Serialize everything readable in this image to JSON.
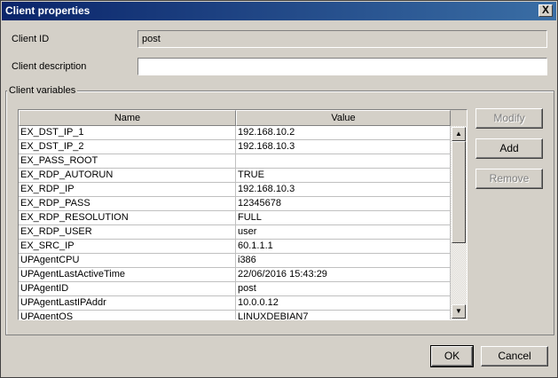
{
  "window": {
    "title": "Client properties",
    "close_glyph": "X"
  },
  "form": {
    "client_id_label": "Client ID",
    "client_id_value": "post",
    "client_description_label": "Client description",
    "client_description_value": ""
  },
  "variables": {
    "group_label": "Client variables",
    "columns": [
      "Name",
      "Value"
    ],
    "rows": [
      [
        "EX_DST_IP_1",
        "192.168.10.2"
      ],
      [
        "EX_DST_IP_2",
        "192.168.10.3"
      ],
      [
        "EX_PASS_ROOT",
        ""
      ],
      [
        "EX_RDP_AUTORUN",
        "TRUE"
      ],
      [
        "EX_RDP_IP",
        "192.168.10.3"
      ],
      [
        "EX_RDP_PASS",
        "12345678"
      ],
      [
        "EX_RDP_RESOLUTION",
        "FULL"
      ],
      [
        "EX_RDP_USER",
        "user"
      ],
      [
        "EX_SRC_IP",
        "60.1.1.1"
      ],
      [
        "UPAgentCPU",
        "i386"
      ],
      [
        "UPAgentLastActiveTime",
        "22/06/2016 15:43:29"
      ],
      [
        "UPAgentID",
        "post"
      ],
      [
        "UPAgentLastIPAddr",
        "10.0.0.12"
      ],
      [
        "UPAgentOS",
        "LINUXDEBIAN7"
      ]
    ],
    "buttons": {
      "modify": "Modify",
      "add": "Add",
      "remove": "Remove"
    }
  },
  "footer": {
    "ok": "OK",
    "cancel": "Cancel"
  },
  "icons": {
    "close": "close-icon",
    "scroll_up": "scroll-up-icon",
    "scroll_down": "scroll-down-icon"
  },
  "colors": {
    "title_bar": "#0a246a",
    "dialog_bg": "#d4d0c8"
  }
}
